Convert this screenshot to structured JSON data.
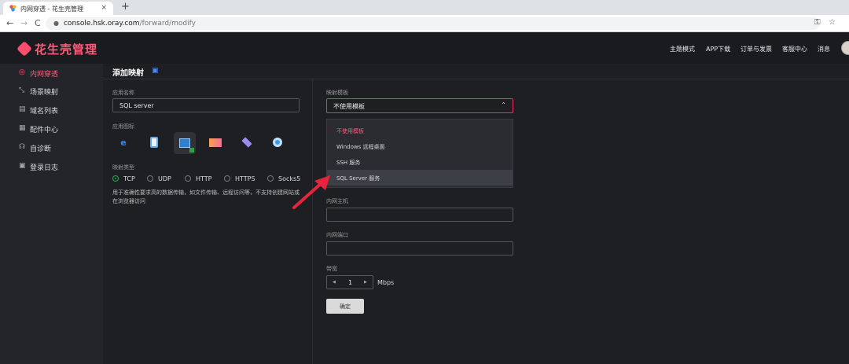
{
  "browser": {
    "tab_title": "内网穿透 - 花生壳管理",
    "tab_close": "×",
    "new_tab": "+",
    "nav_back": "←",
    "nav_forward": "→",
    "nav_reload": "C",
    "url_host": "console.hsk.oray.com",
    "url_path": "/forward/modify",
    "key_icon": "key-icon",
    "star_icon": "star-icon"
  },
  "header": {
    "logo_text": "花生壳管理",
    "nav": [
      "主题模式",
      "APP下载",
      "订单与发票",
      "客服中心",
      "消息"
    ]
  },
  "sidebar": {
    "items": [
      {
        "label": "内网穿透",
        "icon": "link-icon",
        "glyph": "◎",
        "active": true
      },
      {
        "label": "场景映射",
        "icon": "scene-icon",
        "glyph": "⤡",
        "active": false
      },
      {
        "label": "域名列表",
        "icon": "domain-icon",
        "glyph": "▤",
        "active": false
      },
      {
        "label": "配件中心",
        "icon": "grid-icon",
        "glyph": "▦",
        "active": false
      },
      {
        "label": "自诊断",
        "icon": "diagnose-icon",
        "glyph": "☊",
        "active": false
      },
      {
        "label": "登录日志",
        "icon": "log-icon",
        "glyph": "▣",
        "active": false
      }
    ]
  },
  "page": {
    "title": "添加映射",
    "app_name_label": "应用名称",
    "app_name_value": "SQL server",
    "app_icon_label": "应用图标",
    "app_icons": [
      "ie-icon",
      "tablet-icon",
      "monitor-icon",
      "photo-icon",
      "layers-icon",
      "webcam-icon"
    ],
    "map_type_label": "映射类型",
    "map_types": [
      "TCP",
      "UDP",
      "HTTP",
      "HTTPS",
      "Socks5"
    ],
    "selected_type": "TCP",
    "help_text": "用于准确性要求高的数据传输，如文件传输、远程访问等，不支持创建网站或在浏览器访问",
    "template_label": "映射模板",
    "template_value": "不使用模板",
    "template_options": [
      "不使用模板",
      "Windows 远程桌面",
      "SSH 服务",
      "SQL Server 服务"
    ],
    "template_hovered": "SQL Server 服务",
    "inner_host_label": "内网主机",
    "inner_port_label": "内网端口",
    "bandwidth_label": "带宽",
    "bandwidth_value": "1",
    "bandwidth_unit": "Mbps",
    "stepper_dec": "◀",
    "stepper_inc": "▶",
    "confirm_label": "确定"
  },
  "colors": {
    "accent": "#ff5a7a",
    "arrow": "#e8243c",
    "radio_on": "#2ea043"
  }
}
